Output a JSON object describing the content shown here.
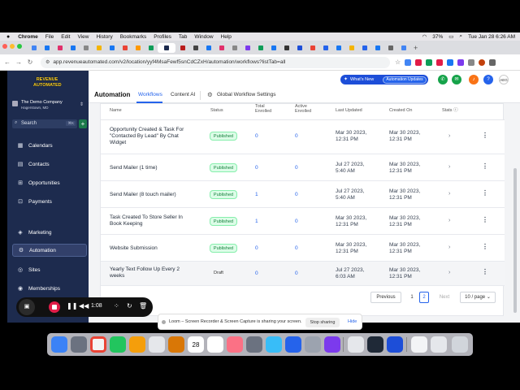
{
  "menubar": {
    "app": "Chrome",
    "items": [
      "File",
      "Edit",
      "View",
      "History",
      "Bookmarks",
      "Profiles",
      "Tab",
      "Window",
      "Help"
    ],
    "battery": "37%",
    "datetime": "Tue Jan 28  6:26 AM"
  },
  "browser": {
    "url": "app.revenueautomated.com/v2/location/yyf4MsaFewf5snCdCZxH/automation/workflows?listTab=all"
  },
  "sidebar": {
    "logo_line1": "REVENUE",
    "logo_line2": "AUTOMATED",
    "account_name": "The Demo Company",
    "account_location": "Hagerstown, MD",
    "search_label": "Search",
    "search_shortcut": "⌘K",
    "items": [
      {
        "label": "Calendars",
        "icon": "calendar-icon"
      },
      {
        "label": "Contacts",
        "icon": "contacts-icon"
      },
      {
        "label": "Opportunities",
        "icon": "funnel-icon"
      },
      {
        "label": "Payments",
        "icon": "payments-icon"
      },
      {
        "label": "Marketing",
        "icon": "marketing-icon"
      },
      {
        "label": "Automation",
        "icon": "automation-icon"
      },
      {
        "label": "Sites",
        "icon": "globe-icon"
      },
      {
        "label": "Memberships",
        "icon": "memberships-icon"
      }
    ]
  },
  "topbar": {
    "whats_new": "What's New",
    "automation_updates": "Automation Updates",
    "avatar": "AEG"
  },
  "header": {
    "title": "Automation",
    "tabs": [
      "Workflows",
      "Content AI"
    ],
    "global_settings": "Global Workflow Settings"
  },
  "table": {
    "columns": [
      "Name",
      "Status",
      "Total Enrolled",
      "Active Enrolled",
      "Last Updated",
      "Created On",
      "Stats"
    ],
    "rows": [
      {
        "name": "Opportunity Created  & Task For \"Contacted By Lead\" By Chat Widget",
        "status": "Published",
        "total": "0",
        "active": "0",
        "updated": [
          "Mar 30 2023,",
          "12:31 PM"
        ],
        "created": [
          "Mar 30 2023,",
          "12:31 PM"
        ]
      },
      {
        "name": "Send Mailer (1 time)",
        "status": "Published",
        "total": "0",
        "active": "0",
        "updated": [
          "Jul 27 2023,",
          "5:40 AM"
        ],
        "created": [
          "Mar 30 2023,",
          "12:31 PM"
        ]
      },
      {
        "name": "Send Mailer (8 touch mailer)",
        "status": "Published",
        "total": "1",
        "active": "0",
        "updated": [
          "Jul 27 2023,",
          "5:40 AM"
        ],
        "created": [
          "Mar 30 2023,",
          "12:31 PM"
        ]
      },
      {
        "name": "Task Created To Store Seller In Book Keeping",
        "status": "Published",
        "total": "1",
        "active": "0",
        "updated": [
          "Mar 30 2023,",
          "12:31 PM"
        ],
        "created": [
          "Mar 30 2023,",
          "12:31 PM"
        ]
      },
      {
        "name": "Website Submission",
        "status": "Published",
        "total": "0",
        "active": "0",
        "updated": [
          "Mar 30 2023,",
          "12:31 PM"
        ],
        "created": [
          "Mar 30 2023,",
          "12:31 PM"
        ]
      },
      {
        "name": "Yearly Text Follow Up Every 2 weeks",
        "status": "Draft",
        "total": "0",
        "active": "0",
        "updated": [
          "Jul 27 2023,",
          "6:03 AM"
        ],
        "created": [
          "Mar 30 2023,",
          "12:31 PM"
        ]
      }
    ]
  },
  "pagination": {
    "previous": "Previous",
    "pages": [
      "1",
      "2"
    ],
    "current_page": "2",
    "next": "Next",
    "per_page": "10 / page"
  },
  "recorder": {
    "time": "1:08"
  },
  "loom": {
    "message": "Loom – Screen Recorder & Screen Capture is sharing your screen.",
    "stop": "Stop sharing",
    "hide": "Hide"
  },
  "dock": {
    "calendar_day": "28"
  },
  "colors": {
    "sidebar_bg": "#1d2b4e",
    "accent_blue": "#2563eb",
    "published_green": "#15803d",
    "record_red": "#e11d48"
  }
}
